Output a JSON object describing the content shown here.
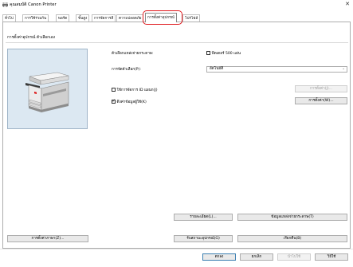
{
  "window": {
    "title": "คุณสมบัติ Canon Printer",
    "close_glyph": "✕"
  },
  "tabs": [
    {
      "label": "ทั่วไป"
    },
    {
      "label": "การใช้ร่วมกัน"
    },
    {
      "label": "พอร์ต"
    },
    {
      "label": "ขั้นสูง"
    },
    {
      "label": "การจัดการสี"
    },
    {
      "label": "ความปลอดภัย"
    },
    {
      "label": "การตั้งค่าอุปกรณ์"
    },
    {
      "label": "โปรไฟล์"
    }
  ],
  "active_tab": "การตั้งค่าอุปกรณ์",
  "highlight_color": "#e0191d",
  "panel": {
    "heading": "การตั้งค่าอุปกรณ์ ตัวเลือกเอง",
    "output_options_label": "ตัวเลือกแหล่งจ่ายกระดาษ:",
    "paper_feeder_label": "ฟีดเดอร์ 500 แผ่น",
    "paper_feeder_checked": false,
    "auto_select_label": "การจัดตัวเลือก(P):",
    "auto_select_value": "อัตโนมัติ",
    "dept_id_label": "ใช้การจัดการ ID แผนก(J)",
    "dept_id_checked": false,
    "dept_settings_button": "การตั้งค่า(J)...",
    "get_info_label": "ดึงค่าข้อมูลผู้ใช้(K)",
    "get_info_checked": true,
    "get_info_settings_button": "การตั้งค่า(W)...",
    "about_button": "รายละเอียด(L)...",
    "paper_source_info_button": "ข้อมูลแหล่งจ่ายกระดาษ(T)",
    "language_settings_button": "การตั้งค่าภาษา(Z)...",
    "get_device_info_button": "รับสถานะอุปกรณ์(G)",
    "restore_defaults_button": "เรียกคืน(B)"
  },
  "footer": {
    "ok": "ตกลง",
    "cancel": "ยกเลิก",
    "apply": "นำไปใช้",
    "help": "วิธีใช้"
  }
}
